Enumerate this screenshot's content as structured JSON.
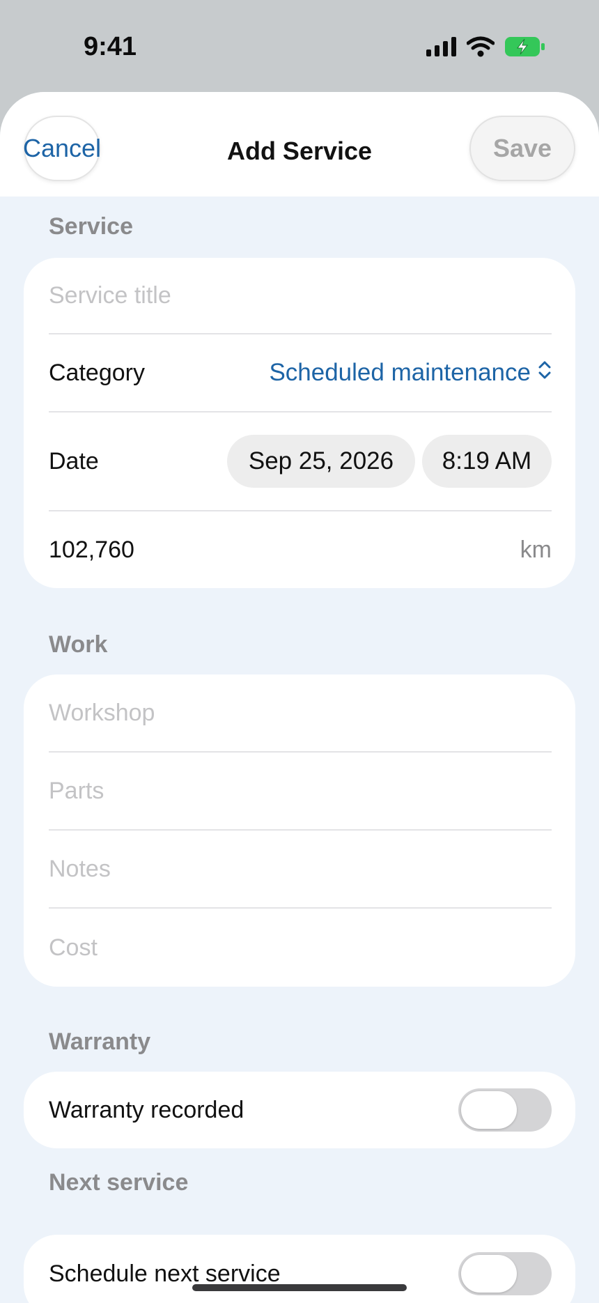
{
  "status_bar": {
    "time": "9:41",
    "icons": [
      "cellular-signal-icon",
      "wifi-icon",
      "battery-charging-icon"
    ],
    "battery_color": "#34c759"
  },
  "nav": {
    "title": "Add Service",
    "cancel_label": "Cancel",
    "save_label": "Save"
  },
  "sections": {
    "service": {
      "label": "Service",
      "title_placeholder": "Service title",
      "category_label": "Category",
      "category_value": "Scheduled maintenance",
      "date_label": "Date",
      "date_value": "Sep 25, 2026",
      "time_value": "8:19 AM",
      "odometer_value": "102,760",
      "odometer_unit": "km"
    },
    "work": {
      "label": "Work",
      "workshop_placeholder": "Workshop",
      "parts_placeholder": "Parts",
      "notes_placeholder": "Notes",
      "cost_placeholder": "Cost"
    },
    "warranty": {
      "label": "Warranty",
      "toggle_label": "Warranty recorded",
      "toggle_on": false
    },
    "next_service": {
      "label": "Next service",
      "toggle_label": "Schedule next service",
      "toggle_on": false
    }
  },
  "colors": {
    "accent": "#1d64a6",
    "background": "#edf3fa",
    "card": "#ffffff",
    "placeholder": "#c3c3c5"
  }
}
